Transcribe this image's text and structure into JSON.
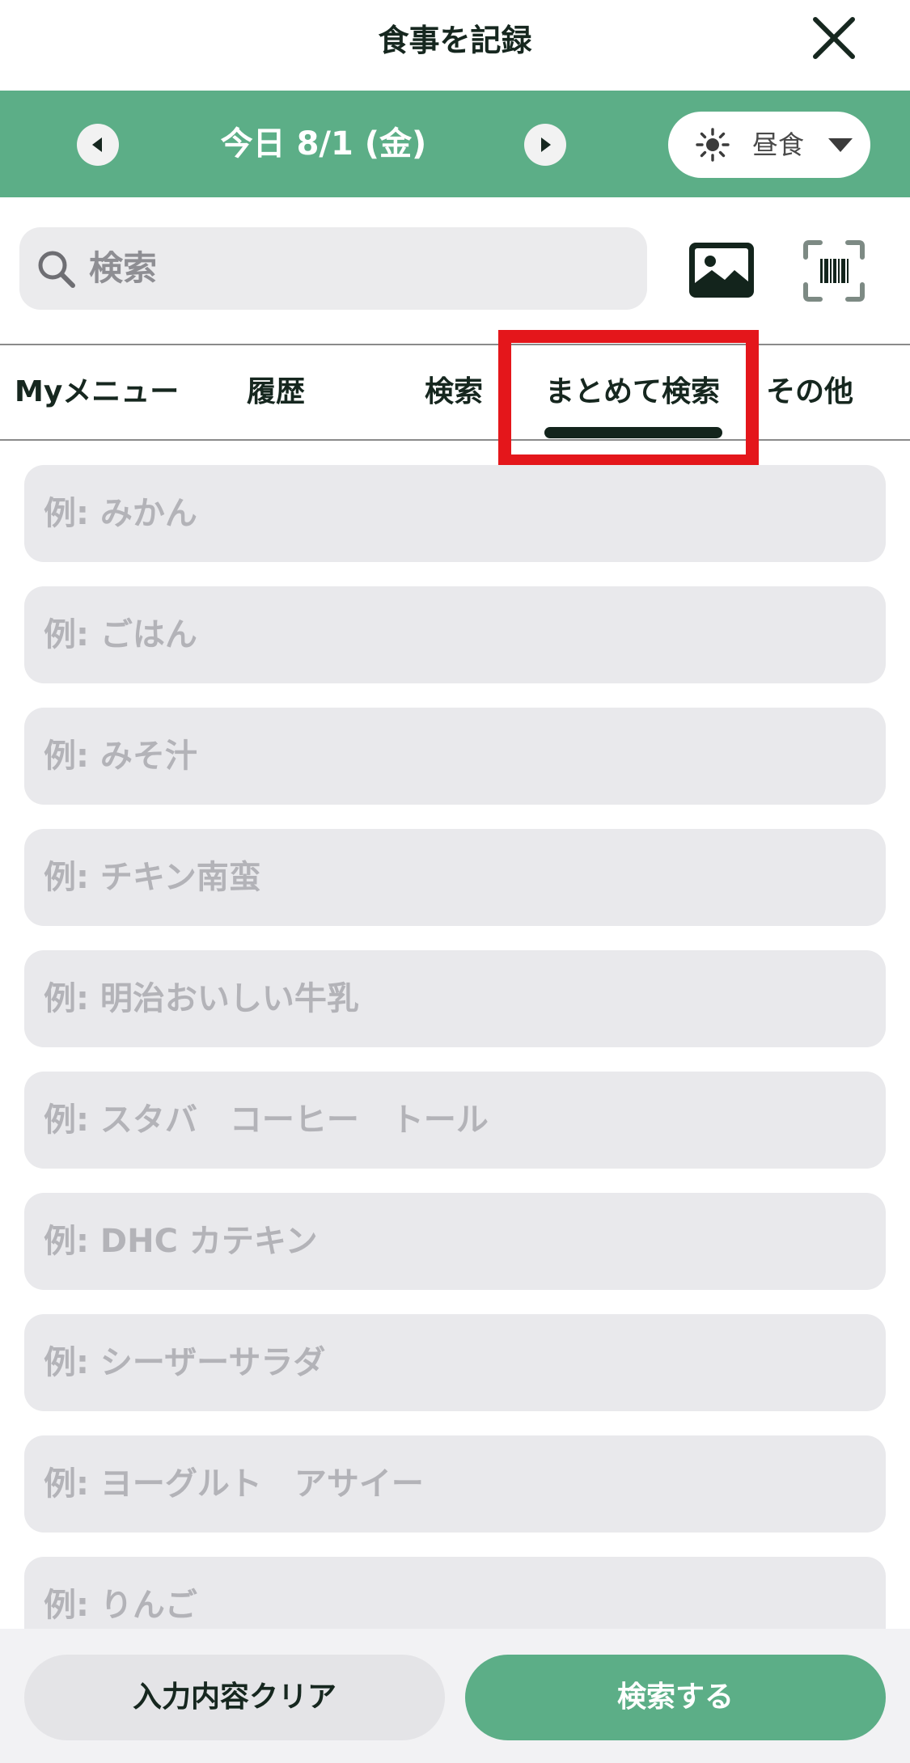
{
  "header": {
    "title": "食事を記録",
    "close_icon": "close-icon"
  },
  "date_bar": {
    "date_label": "今日 8/1 (金)",
    "prev_icon": "triangle-left-icon",
    "next_icon": "triangle-right-icon",
    "meal": {
      "label": "昼食",
      "icon": "sun-icon",
      "caret_icon": "caret-down-icon"
    }
  },
  "search": {
    "placeholder": "検索",
    "icon": "magnifier-icon",
    "photo_icon": "image-icon",
    "barcode_icon": "barcode-scan-icon"
  },
  "tabs": [
    {
      "label": "Myメニュー"
    },
    {
      "label": "履歴"
    },
    {
      "label": "検索"
    },
    {
      "label": "まとめて検索",
      "selected": true
    },
    {
      "label": "その他"
    }
  ],
  "highlight_color": "#e4161b",
  "accent_color": "#5cae87",
  "entries": [
    {
      "placeholder": "例: みかん"
    },
    {
      "placeholder": "例: ごはん"
    },
    {
      "placeholder": "例: みそ汁"
    },
    {
      "placeholder": "例: チキン南蛮"
    },
    {
      "placeholder": "例: 明治おいしい牛乳"
    },
    {
      "placeholder": "例: スタバ　コーヒー　トール"
    },
    {
      "placeholder": "例: DHC カテキン"
    },
    {
      "placeholder": "例: シーザーサラダ"
    },
    {
      "placeholder": "例: ヨーグルト　アサイー"
    },
    {
      "placeholder": "例: りんご"
    }
  ],
  "footer": {
    "clear_label": "入力内容クリア",
    "search_label": "検索する"
  }
}
